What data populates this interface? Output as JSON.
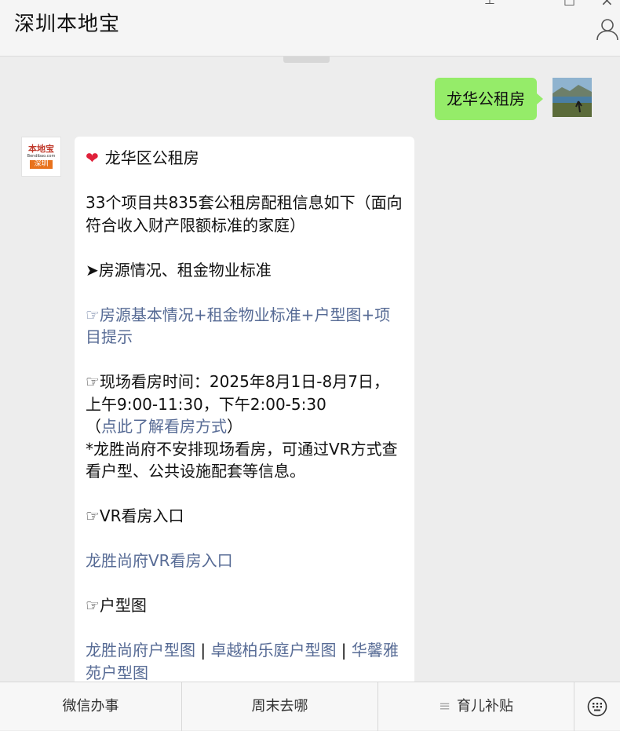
{
  "header": {
    "title": "深圳本地宝"
  },
  "conversation": {
    "user_message": "龙华公租房",
    "bot_avatar": {
      "line1": "本地宝",
      "line2": "Bendibao.com",
      "line3": "深圳"
    },
    "bot_message": {
      "heading": "龙华区公租房",
      "intro": "33个项目共835套公租房配租信息如下（面向符合收入财产限额标准的家庭）",
      "section_title": "➤房源情况、租金物业标准",
      "basic_info_link": "☞房源基本情况+租金物业标准+户型图+项目提示",
      "viewing_time_1": "☞现场看房时间：2025年8月1日-8月7日，上午9:00-11:30，下午2:00-5:30",
      "viewing_paren_open": "（",
      "viewing_link": "点此了解看房方式",
      "viewing_paren_close": "）",
      "note": "*龙胜尚府不安排现场看房，可通过VR方式查看户型、公共设施配套等信息。",
      "vr_title": "☞VR看房入口",
      "vr_link": "龙胜尚府VR看房入口",
      "floorplan_title": "☞户型图",
      "floorplan_link_1": "龙胜尚府户型图",
      "separator_1": " | ",
      "floorplan_link_2": "卓越柏乐庭户型图",
      "separator_2": " | ",
      "floorplan_link_3": "华馨雅苑户型图"
    }
  },
  "bottom_menu": {
    "item1": "微信办事",
    "item2": "周末去哪",
    "item3": "育儿补贴"
  },
  "colors": {
    "user_bubble": "#95ec69",
    "link": "#576b95",
    "background": "#ededed"
  }
}
